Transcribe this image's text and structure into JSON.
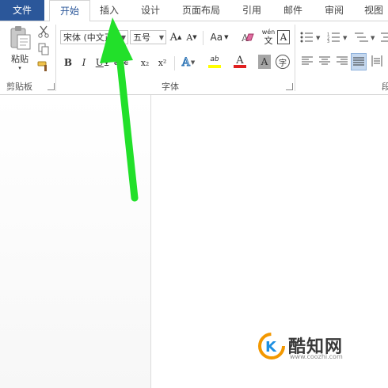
{
  "tabs": [
    {
      "label": "文件"
    },
    {
      "label": "开始"
    },
    {
      "label": "插入"
    },
    {
      "label": "设计"
    },
    {
      "label": "页面布局"
    },
    {
      "label": "引用"
    },
    {
      "label": "邮件"
    },
    {
      "label": "审阅"
    },
    {
      "label": "视图"
    }
  ],
  "clipboard": {
    "paste_label": "粘贴",
    "group_label": "剪贴板"
  },
  "font": {
    "font_name": "宋体 (中文正",
    "font_size": "五号",
    "change_case": "Aa",
    "phonetic_top": "wén",
    "phonetic_bottom": "文",
    "group_label": "字体",
    "bold": "B",
    "italic": "I",
    "underline": "U",
    "strikethrough": "abc",
    "subscript": "x₂",
    "superscript": "x²",
    "grow": "A",
    "shrink": "A",
    "char_border": "A",
    "char_shade": "A",
    "font_color": "A",
    "effects": "A",
    "highlight": "ab",
    "enclose": "字"
  },
  "paragraph": {
    "group_label": "段"
  },
  "watermark": {
    "brand": "酷知网",
    "url": "www.coozhi.com"
  },
  "colors": {
    "file_tab": "#2b579a",
    "arrow": "#22e02a",
    "highlight_yellow": "#ffff00",
    "font_color_red": "#e02020",
    "logo_orange": "#f39800",
    "logo_blue": "#1e8fe1"
  }
}
